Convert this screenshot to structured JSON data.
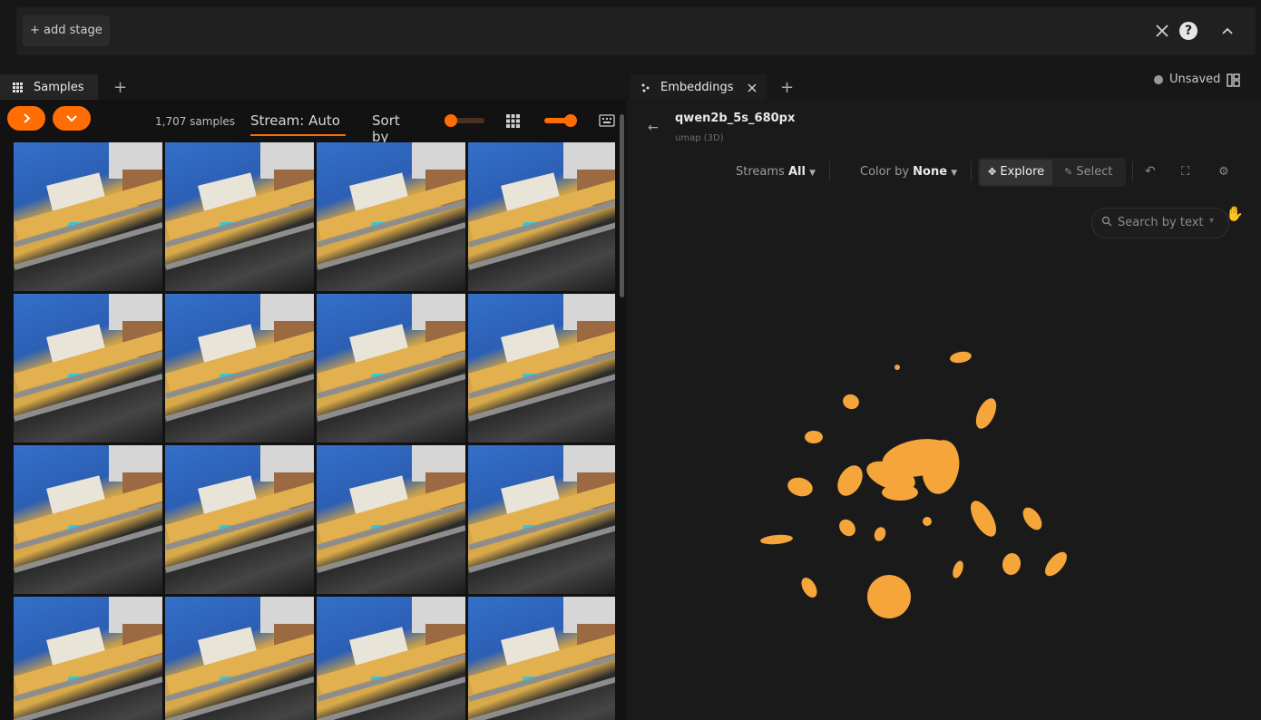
{
  "viewbar": {
    "add_stage_label": "+ add stage"
  },
  "tabs": {
    "samples_label": "Samples",
    "embeddings_label": "Embeddings",
    "add_label": "+",
    "unsaved_label": "Unsaved"
  },
  "samples": {
    "count_label": "1,707 samples",
    "stream_label": "Stream: Auto",
    "sort_label": "Sort by",
    "grid_rows": 4,
    "grid_cols": 4
  },
  "embeddings": {
    "name": "qwen2b_5s_680px",
    "method": "umap (3D)",
    "streams_label": "Streams",
    "streams_value": "All",
    "color_by_label": "Color by",
    "color_by_value": "None",
    "explore_label": "Explore",
    "select_label": "Select",
    "search_placeholder": "Search by text"
  },
  "colors": {
    "accent": "#ff6d04",
    "points": "#f5a53a",
    "background": "#171717"
  },
  "icons": [
    "grid-icon",
    "close-icon",
    "help-icon",
    "chevron-up-icon",
    "layout-icon",
    "embeddings-icon",
    "back-arrow-icon",
    "explore-icon",
    "select-icon",
    "undo-icon",
    "fullscreen-icon",
    "settings-icon",
    "search-icon",
    "chevron-down-icon",
    "hand-cursor-icon"
  ]
}
